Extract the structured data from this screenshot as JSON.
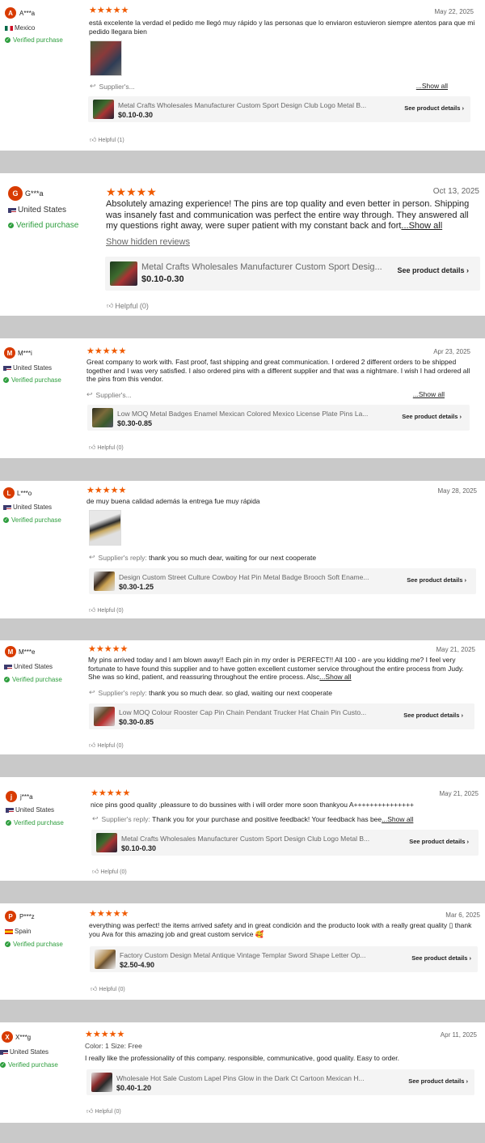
{
  "reviews": [
    {
      "initial": "A",
      "user": "A***a",
      "country": "Mexico",
      "verified": "Verified purchase",
      "stars": "★★★★★",
      "date": "May 22, 2025",
      "text": "está excelente la verdad el pedido me llegó muy rápido y las personas que lo enviaron estuvieron siempre atentos para que mi pedido llegara bien",
      "supplier_label": "Supplier's...",
      "supplier_reply": "",
      "show_all": "...Show all",
      "product_title": "Metal Crafts Wholesales Manufacturer Custom Sport Design Club Logo Metal B...",
      "price": "$0.10-0.30",
      "details": "See product details ›",
      "helpful": "Helpful (1)"
    },
    {
      "initial": "G",
      "user": "G***a",
      "country": "United States",
      "verified": "Verified purchase",
      "stars": "★★★★★",
      "date": "Oct 13, 2025",
      "text": "Absolutely amazing experience! The pins are top quality and even better in person. Shipping was insanely fast and communication was perfect the entire way through. They answered all my questions right away, were super patient with my constant back and fort",
      "show_all": "...Show all",
      "hidden": "Show hidden reviews",
      "product_title": "Metal Crafts Wholesales Manufacturer Custom Sport Desig...",
      "price": "$0.10-0.30",
      "details": "See product details ›",
      "helpful": "Helpful (0)"
    },
    {
      "initial": "M",
      "user": "M***i",
      "country": "United States",
      "verified": "Verified purchase",
      "stars": "★★★★★",
      "date": "Apr 23, 2025",
      "text": "Great company to work with. Fast proof, fast shipping and great communication. I ordered 2 different orders to be shipped together and I was very satisfied. I also ordered pins with a different supplier and that was a nightmare.  I wish I had ordered all the pins from this vendor.",
      "supplier_label": "Supplier's...",
      "supplier_reply": "",
      "show_all": "...Show all",
      "product_title": "Low MOQ Metal Badges Enamel Mexican Colored Mexico License Plate Pins La...",
      "price": "$0.30-0.85",
      "details": "See product details ›",
      "helpful": "Helpful (0)"
    },
    {
      "initial": "L",
      "user": "L***o",
      "country": "United States",
      "verified": "Verified purchase",
      "stars": "★★★★★",
      "date": "May 28, 2025",
      "text": "de muy buena calidad además la entrega fue muy rápida",
      "supplier_label": "Supplier's reply:",
      "supplier_reply": "thank you so much dear, waiting for our next cooperate",
      "product_title": "Design Custom Street Culture Cowboy Hat Pin Metal Badge Brooch Soft Ename...",
      "price": "$0.30-1.25",
      "details": "See product details ›",
      "helpful": "Helpful (0)"
    },
    {
      "initial": "M",
      "user": "M***e",
      "country": "United States",
      "verified": "Verified purchase",
      "stars": "★★★★★",
      "date": "May 21, 2025",
      "text": "My pins arrived today and I am blown away!! Each pin in my order is PERFECT!! All 100 - are you kidding me? I feel very fortunate to have found this supplier and to have gotten excellent customer service throughout the entire process from Judy. She was so kind, patient, and reassuring throughout the entire process. Alsc",
      "show_all": "...Show all",
      "supplier_label": "Supplier's reply:",
      "supplier_reply": "thank you so much dear. so glad, waiting our next cooperate",
      "product_title": "Low MOQ Colour Rooster Cap Pin Chain Pendant Trucker Hat Chain Pin Custo...",
      "price": "$0.30-0.85",
      "details": "See product details ›",
      "helpful": "Helpful (0)"
    },
    {
      "initial": "j",
      "user": "j***a",
      "country": "United States",
      "verified": "Verified purchase",
      "stars": "★★★★★",
      "date": "May 21, 2025",
      "text": "nice pins good quality ,pleassure to do bussines with i will order more soon thankyou A+++++++++++++++",
      "supplier_label": "Supplier's reply:",
      "supplier_reply": "Thank you for your purchase and positive feedback! Your feedback has bee",
      "show_all": "...Show all",
      "product_title": "Metal Crafts Wholesales Manufacturer Custom Sport Design Club Logo Metal B...",
      "price": "$0.10-0.30",
      "details": "See product details ›",
      "helpful": "Helpful (0)"
    },
    {
      "initial": "P",
      "user": "P***z",
      "country": "Spain",
      "verified": "Verified purchase",
      "stars": "★★★★★",
      "date": "Mar 6, 2025",
      "text": "everything was perfect! the items arrived safety and in great condición and the producto look with a really great quality ▯ thank you Ava for this amazing job and great custom service 🥰",
      "product_title": "Factory Custom Design Metal Antique Vintage Templar Sword Shape Letter Op...",
      "price": "$2.50-4.90",
      "details": "See product details ›",
      "helpful": "Helpful (0)"
    },
    {
      "initial": "X",
      "user": "X***g",
      "country": "United States",
      "verified": "Verified purchase",
      "stars": "★★★★★",
      "date": "Apr 11, 2025",
      "attrs": "Color:  1     Size:  Free",
      "text": "I really like the professionality of this company. responsible, communicative, good quality. Easy to order.",
      "product_title": "Wholesale Hot Sale Custom Lapel Pins Glow in the Dark Ct Cartoon Mexican H...",
      "price": "$0.40-1.20",
      "details": "See product details ›",
      "helpful": "Helpful (0)"
    }
  ],
  "colors": {
    "accent": "#f05a00",
    "verified": "#2e9e3e",
    "avatar": "#d83b01"
  }
}
